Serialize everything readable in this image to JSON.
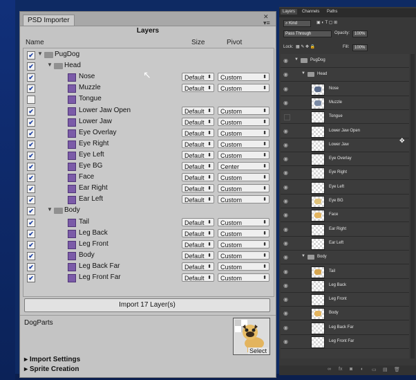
{
  "unity": {
    "tab_title": "PSD Importer",
    "heading": "Layers",
    "col_name": "Name",
    "col_size": "Size",
    "col_pivot": "Pivot",
    "rows": [
      {
        "label": "PugDog",
        "type": "group",
        "depth": 0,
        "checked": true
      },
      {
        "label": "Head",
        "type": "group",
        "depth": 1,
        "checked": true
      },
      {
        "label": "Nose",
        "type": "layer",
        "depth": 2,
        "checked": true,
        "size": "Default",
        "pivot": "Custom"
      },
      {
        "label": "Muzzle",
        "type": "layer",
        "depth": 2,
        "checked": true,
        "size": "Default",
        "pivot": "Custom"
      },
      {
        "label": "Tongue",
        "type": "layer",
        "depth": 2,
        "checked": false
      },
      {
        "label": "Lower Jaw Open",
        "type": "layer",
        "depth": 2,
        "checked": true,
        "size": "Default",
        "pivot": "Custom"
      },
      {
        "label": "Lower Jaw",
        "type": "layer",
        "depth": 2,
        "checked": true,
        "size": "Default",
        "pivot": "Custom"
      },
      {
        "label": "Eye Overlay",
        "type": "layer",
        "depth": 2,
        "checked": true,
        "size": "Default",
        "pivot": "Custom"
      },
      {
        "label": "Eye Right",
        "type": "layer",
        "depth": 2,
        "checked": true,
        "size": "Default",
        "pivot": "Custom"
      },
      {
        "label": "Eye Left",
        "type": "layer",
        "depth": 2,
        "checked": true,
        "size": "Default",
        "pivot": "Custom"
      },
      {
        "label": "Eye BG",
        "type": "layer",
        "depth": 2,
        "checked": true,
        "size": "Default",
        "pivot": "Center"
      },
      {
        "label": "Face",
        "type": "layer",
        "depth": 2,
        "checked": true,
        "size": "Default",
        "pivot": "Custom"
      },
      {
        "label": "Ear Right",
        "type": "layer",
        "depth": 2,
        "checked": true,
        "size": "Default",
        "pivot": "Custom"
      },
      {
        "label": "Ear Left",
        "type": "layer",
        "depth": 2,
        "checked": true,
        "size": "Default",
        "pivot": "Custom"
      },
      {
        "label": "Body",
        "type": "group",
        "depth": 1,
        "checked": true
      },
      {
        "label": "Tail",
        "type": "layer",
        "depth": 2,
        "checked": true,
        "size": "Default",
        "pivot": "Custom"
      },
      {
        "label": "Leg Back",
        "type": "layer",
        "depth": 2,
        "checked": true,
        "size": "Default",
        "pivot": "Custom"
      },
      {
        "label": "Leg Front",
        "type": "layer",
        "depth": 2,
        "checked": true,
        "size": "Default",
        "pivot": "Custom"
      },
      {
        "label": "Body",
        "type": "layer",
        "depth": 2,
        "checked": true,
        "size": "Default",
        "pivot": "Custom"
      },
      {
        "label": "Leg Back Far",
        "type": "layer",
        "depth": 2,
        "checked": true,
        "size": "Default",
        "pivot": "Custom"
      },
      {
        "label": "Leg Front Far",
        "type": "layer",
        "depth": 2,
        "checked": true,
        "size": "Default",
        "pivot": "Custom"
      }
    ],
    "import_button": "Import 17 Layer(s)",
    "asset_name": "DogParts",
    "select_label": "Select",
    "import_settings": "Import Settings",
    "sprite_creation": "Sprite Creation"
  },
  "ps": {
    "tabs": [
      "Layers",
      "Channels",
      "Paths"
    ],
    "kind": "Kind",
    "blend_mode": "Pass Through",
    "opacity_label": "Opacity:",
    "opacity": "100%",
    "lock_label": "Lock:",
    "fill_label": "Fill:",
    "fill": "100%",
    "rows": [
      {
        "label": "PugDog",
        "type": "group",
        "depth": 0,
        "visible": true
      },
      {
        "label": "Head",
        "type": "group",
        "depth": 1,
        "visible": true
      },
      {
        "label": "Nose",
        "type": "layer",
        "depth": 2,
        "visible": true
      },
      {
        "label": "Muzzle",
        "type": "layer",
        "depth": 2,
        "visible": true
      },
      {
        "label": "Tongue",
        "type": "layer",
        "depth": 2,
        "visible": false
      },
      {
        "label": "Lower Jaw Open",
        "type": "layer",
        "depth": 2,
        "visible": true
      },
      {
        "label": "Lower Jaw",
        "type": "layer",
        "depth": 2,
        "visible": true
      },
      {
        "label": "Eye Overlay",
        "type": "layer",
        "depth": 2,
        "visible": true
      },
      {
        "label": "Eye Right",
        "type": "layer",
        "depth": 2,
        "visible": true
      },
      {
        "label": "Eye Left",
        "type": "layer",
        "depth": 2,
        "visible": true
      },
      {
        "label": "Eye BG",
        "type": "layer",
        "depth": 2,
        "visible": true
      },
      {
        "label": "Face",
        "type": "layer",
        "depth": 2,
        "visible": true
      },
      {
        "label": "Ear Right",
        "type": "layer",
        "depth": 2,
        "visible": true
      },
      {
        "label": "Ear Left",
        "type": "layer",
        "depth": 2,
        "visible": true
      },
      {
        "label": "Body",
        "type": "group",
        "depth": 1,
        "visible": true
      },
      {
        "label": "Tail",
        "type": "layer",
        "depth": 2,
        "visible": true
      },
      {
        "label": "Leg Back",
        "type": "layer",
        "depth": 2,
        "visible": true
      },
      {
        "label": "Leg Front",
        "type": "layer",
        "depth": 2,
        "visible": true
      },
      {
        "label": "Body",
        "type": "layer",
        "depth": 2,
        "visible": true
      },
      {
        "label": "Leg Back Far",
        "type": "layer",
        "depth": 2,
        "visible": true
      },
      {
        "label": "Leg Front Far",
        "type": "layer",
        "depth": 2,
        "visible": true
      }
    ]
  }
}
